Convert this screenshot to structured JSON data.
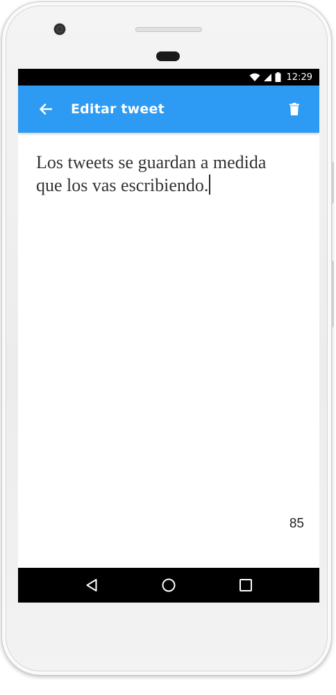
{
  "status_bar": {
    "time": "12:29",
    "icons": [
      "wifi-icon",
      "signal-icon",
      "battery-icon"
    ]
  },
  "app_bar": {
    "title": "Editar tweet",
    "back_icon": "arrow-left-icon",
    "delete_icon": "trash-icon",
    "color": "#2d9af3"
  },
  "editor": {
    "text": "Los tweets se guardan a medida\nque los vas escribiendo."
  },
  "counter": "85",
  "nav_bar": {
    "buttons": [
      "back-triangle-icon",
      "home-circle-icon",
      "recents-square-icon"
    ]
  }
}
